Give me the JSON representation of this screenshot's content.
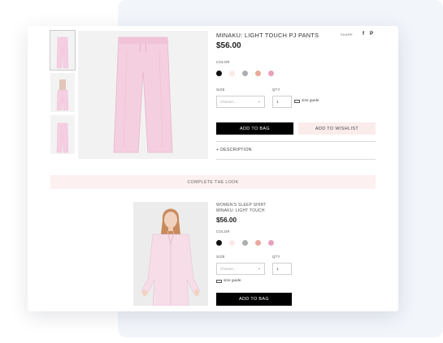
{
  "product": {
    "title": "MINAKU: LIGHT TOUCH PJ PANTS",
    "price": "$56.00",
    "share_label": "SHARE",
    "share_icons": [
      "facebook-icon",
      "pinterest-icon"
    ],
    "facebook_glyph": "f",
    "pinterest_glyph": "P",
    "color_label": "COLOR",
    "colors": [
      "#111111",
      "#fbe9e7",
      "#adadad",
      "#e9a99b",
      "#e8a2bd"
    ],
    "size_label": "SIZE",
    "size_placeholder": "Choose...",
    "qty_label": "QTY",
    "qty_value": "1",
    "size_guide_label": "size guide",
    "add_to_bag_label": "ADD TO BAG",
    "add_to_wishlist_label": "ADD TO WISHLIST",
    "description_label": "+ DESCRIPTION",
    "thumbnail_count": 3
  },
  "complete_the_look": {
    "heading": "COMPLETE THE LOOK",
    "item": {
      "name_line1": "WOMEN'S SLEEP SHIRT",
      "name_line2": "MINAKU: LIGHT TOUCH",
      "price": "$56.00",
      "color_label": "COLOR",
      "colors": [
        "#111111",
        "#fbe9e7",
        "#adadad",
        "#e9a99b",
        "#e8a2bd"
      ],
      "size_label": "SIZE",
      "size_placeholder": "Choose...",
      "qty_label": "QTY",
      "qty_value": "1",
      "size_guide_label": "size guide",
      "add_to_bag_label": "ADD TO BAG"
    }
  },
  "theme": {
    "accent_pink": "#fbecec",
    "button_black": "#000000",
    "product_pink": "#f4cfe0"
  }
}
